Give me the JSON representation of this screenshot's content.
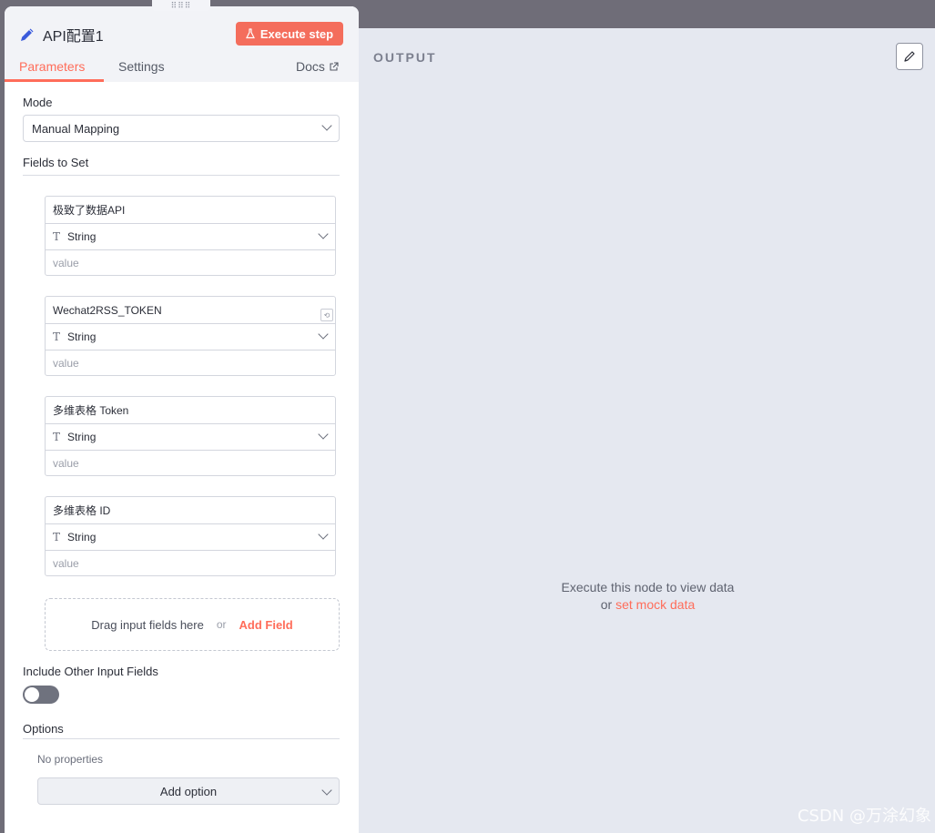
{
  "node": {
    "title": "API配置1",
    "execute_label": "Execute step"
  },
  "tabs": {
    "parameters": "Parameters",
    "settings": "Settings",
    "docs": "Docs"
  },
  "mode": {
    "label": "Mode",
    "value": "Manual Mapping"
  },
  "fields_to_set": {
    "label": "Fields to Set",
    "items": [
      {
        "name": "极致了数据API",
        "type": "String",
        "value_placeholder": "value"
      },
      {
        "name": "Wechat2RSS_TOKEN",
        "type": "String",
        "value_placeholder": "value"
      },
      {
        "name": "多维表格 Token",
        "type": "String",
        "value_placeholder": "value"
      },
      {
        "name": "多维表格 ID",
        "type": "String",
        "value_placeholder": "value"
      }
    ],
    "dropzone_text": "Drag input fields here",
    "dropzone_or": "or",
    "add_field_label": "Add Field"
  },
  "include_other": {
    "label": "Include Other Input Fields",
    "enabled": false
  },
  "options": {
    "label": "Options",
    "empty_text": "No properties",
    "add_option_label": "Add option"
  },
  "output": {
    "label": "OUTPUT",
    "empty_line1": "Execute this node to view data",
    "empty_or": "or",
    "mock_link": "set mock data"
  },
  "watermark": "CSDN @万涂幻象",
  "colors": {
    "accent": "#ff6d5a",
    "background": "#6f6d78",
    "output_bg": "#e5e8f0"
  }
}
